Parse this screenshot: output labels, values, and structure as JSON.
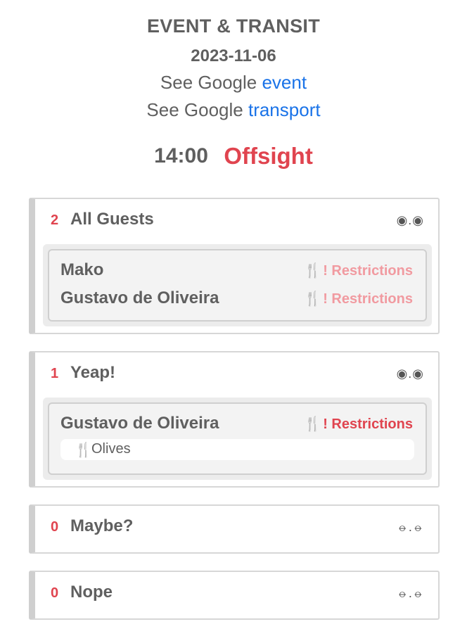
{
  "header": {
    "title": "EVENT & TRANSIT",
    "date": "2023-11-06",
    "see_event_prefix": "See Google ",
    "see_event_link": "event",
    "see_transport_prefix": "See Google ",
    "see_transport_link": "transport",
    "time": "14:00",
    "event_name": "Offsight"
  },
  "colors": {
    "accent_red": "#e0444f",
    "light_red": "#f19aa0",
    "link_blue": "#1a73e8",
    "text_gray": "#5f5f5f"
  },
  "groups": [
    {
      "count": "2",
      "name": "All Guests",
      "toggle_icon": "◉.◉",
      "toggle_icon_name": "eyes-open-icon",
      "guests": [
        {
          "name": "Mako",
          "restriction": "! Restrictions"
        },
        {
          "name": "Gustavo de Oliveira",
          "restriction": "! Restrictions"
        }
      ]
    },
    {
      "count": "1",
      "name": "Yeap!",
      "toggle_icon": "◉.◉",
      "toggle_icon_name": "eyes-open-icon",
      "guests": [
        {
          "name": "Gustavo de Oliveira",
          "restriction": "! Restrictions",
          "note": "Olives"
        }
      ]
    },
    {
      "count": "0",
      "name": "Maybe?",
      "toggle_icon": "⦵.⦵",
      "toggle_icon_name": "eyes-closed-icon",
      "guests": []
    },
    {
      "count": "0",
      "name": "Nope",
      "toggle_icon": "⦵.⦵",
      "toggle_icon_name": "eyes-closed-icon",
      "guests": []
    }
  ],
  "icons": {
    "fork": "🍴"
  }
}
